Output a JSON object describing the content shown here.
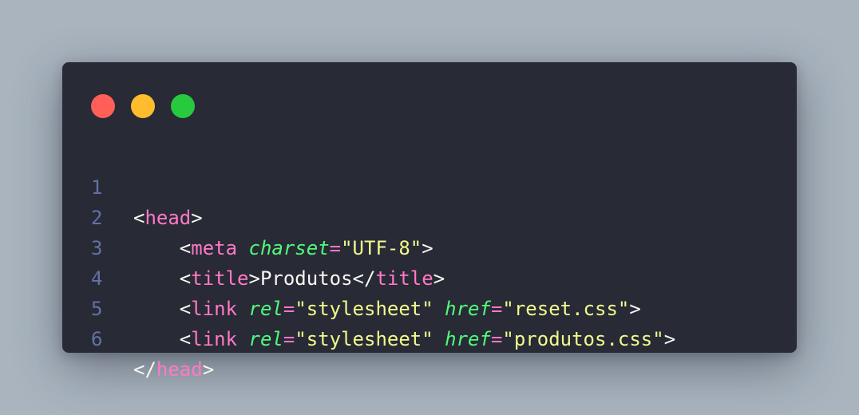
{
  "window": {
    "controls": [
      {
        "name": "close",
        "color": "#ff5f56"
      },
      {
        "name": "minimize",
        "color": "#ffbd2e"
      },
      {
        "name": "maximize",
        "color": "#27c93f"
      }
    ]
  },
  "code": {
    "lines": [
      {
        "number": "1",
        "tokens": [
          {
            "type": "punct",
            "text": "<"
          },
          {
            "type": "tag",
            "text": "head"
          },
          {
            "type": "punct",
            "text": ">"
          }
        ]
      },
      {
        "number": "2",
        "tokens": [
          {
            "type": "punct",
            "text": "    <"
          },
          {
            "type": "tag",
            "text": "meta"
          },
          {
            "type": "punct",
            "text": " "
          },
          {
            "type": "attr",
            "text": "charset"
          },
          {
            "type": "eq",
            "text": "="
          },
          {
            "type": "str",
            "text": "\"UTF-8\""
          },
          {
            "type": "punct",
            "text": ">"
          }
        ]
      },
      {
        "number": "3",
        "tokens": [
          {
            "type": "punct",
            "text": "    <"
          },
          {
            "type": "tag",
            "text": "title"
          },
          {
            "type": "punct",
            "text": ">"
          },
          {
            "type": "txt",
            "text": "Produtos"
          },
          {
            "type": "punct",
            "text": "</"
          },
          {
            "type": "tag",
            "text": "title"
          },
          {
            "type": "punct",
            "text": ">"
          }
        ]
      },
      {
        "number": "4",
        "tokens": [
          {
            "type": "punct",
            "text": "    <"
          },
          {
            "type": "tag",
            "text": "link"
          },
          {
            "type": "punct",
            "text": " "
          },
          {
            "type": "attr",
            "text": "rel"
          },
          {
            "type": "eq",
            "text": "="
          },
          {
            "type": "str",
            "text": "\"stylesheet\""
          },
          {
            "type": "punct",
            "text": " "
          },
          {
            "type": "attr",
            "text": "href"
          },
          {
            "type": "eq",
            "text": "="
          },
          {
            "type": "str",
            "text": "\"reset.css\""
          },
          {
            "type": "punct",
            "text": ">"
          }
        ]
      },
      {
        "number": "5",
        "tokens": [
          {
            "type": "punct",
            "text": "    <"
          },
          {
            "type": "tag",
            "text": "link"
          },
          {
            "type": "punct",
            "text": " "
          },
          {
            "type": "attr",
            "text": "rel"
          },
          {
            "type": "eq",
            "text": "="
          },
          {
            "type": "str",
            "text": "\"stylesheet\""
          },
          {
            "type": "punct",
            "text": " "
          },
          {
            "type": "attr",
            "text": "href"
          },
          {
            "type": "eq",
            "text": "="
          },
          {
            "type": "str",
            "text": "\"produtos.css\""
          },
          {
            "type": "punct",
            "text": ">"
          }
        ]
      },
      {
        "number": "6",
        "tokens": [
          {
            "type": "punct",
            "text": "</"
          },
          {
            "type": "tag",
            "text": "head"
          },
          {
            "type": "punct",
            "text": ">"
          }
        ]
      }
    ]
  }
}
